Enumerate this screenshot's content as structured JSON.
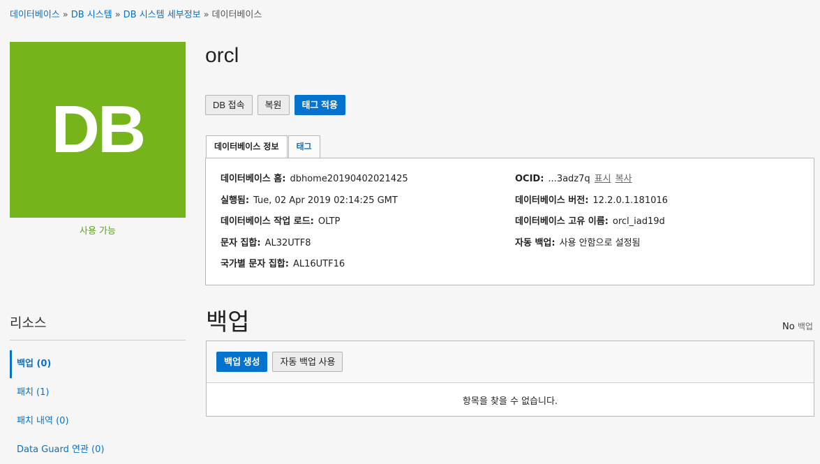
{
  "breadcrumb": {
    "items": [
      "데이터베이스",
      "DB 시스템",
      "DB 시스템 세부정보"
    ],
    "current": "데이터베이스",
    "separator": "»"
  },
  "tile": {
    "text": "DB",
    "color": "#76b41c"
  },
  "status": "사용 가능",
  "title": "orcl",
  "actions": {
    "connect": "DB 접속",
    "restore": "복원",
    "apply_tags": "태그 적용"
  },
  "tabs": {
    "info": "데이터베이스 정보",
    "tags": "태그"
  },
  "info": {
    "left": [
      {
        "k": "데이터베이스 홈:",
        "v": "dbhome20190402021425"
      },
      {
        "k": "실행됨:",
        "v": "Tue, 02 Apr 2019 02:14:25 GMT"
      },
      {
        "k": "데이터베이스 작업 로드:",
        "v": "OLTP"
      },
      {
        "k": "문자 집합:",
        "v": "AL32UTF8"
      },
      {
        "k": "국가별 문자 집합:",
        "v": "AL16UTF16"
      }
    ],
    "right": [
      {
        "k": "OCID:",
        "v": "...3adz7q"
      },
      {
        "k": "데이터베이스 버전:",
        "v": "12.2.0.1.181016"
      },
      {
        "k": "데이터베이스 고유 이름:",
        "v": "orcl_iad19d"
      },
      {
        "k": "자동 백업:",
        "v": "사용 안함으로 설정됨"
      }
    ],
    "ocid_show": "표시",
    "ocid_copy": "복사"
  },
  "resources": {
    "title": "리소스",
    "items": [
      "백업 (0)",
      "패치 (1)",
      "패치 내역 (0)",
      "Data Guard 연관 (0)"
    ]
  },
  "backup": {
    "title": "백업",
    "no_label": "No",
    "no_suffix": "백업",
    "create": "백업 생성",
    "auto": "자동 백업 사용",
    "empty": "항목을 찾을 수 없습니다."
  },
  "colors": {
    "accent": "#0572ce",
    "available": "#5fa11a"
  }
}
